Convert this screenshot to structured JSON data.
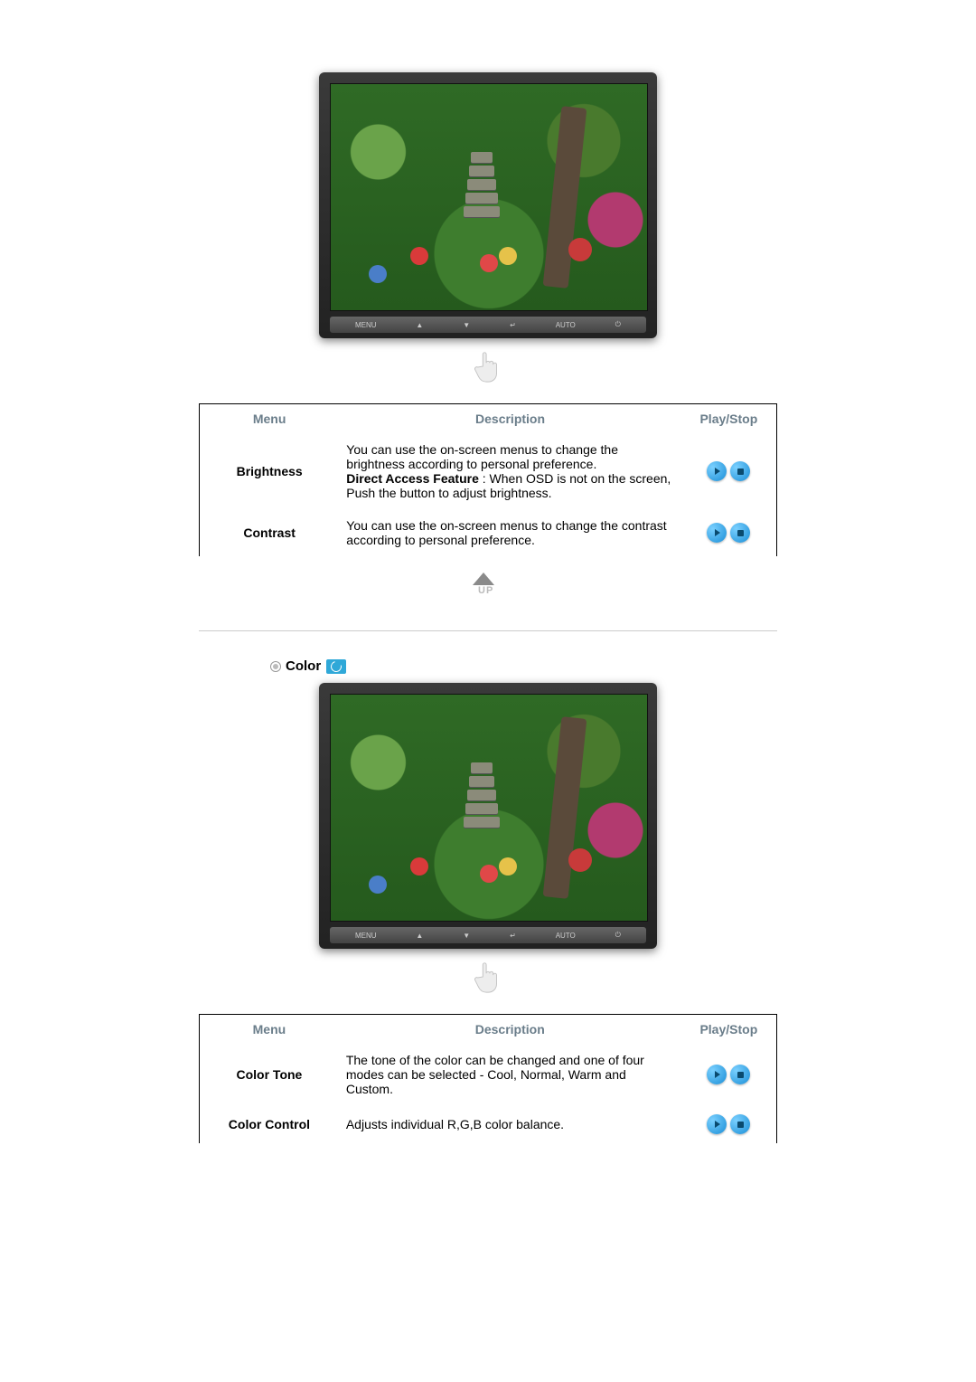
{
  "monitor_bar": {
    "b1": "MENU",
    "b2": "▲",
    "b3": "▼",
    "b4": "↵",
    "b5": "AUTO",
    "b6": "⏻"
  },
  "table1": {
    "head_menu": "Menu",
    "head_desc": "Description",
    "head_play": "Play/Stop",
    "rows": [
      {
        "menu": "Brightness",
        "desc_a": "You can use the on-screen menus to change the brightness according to personal preference.",
        "desc_b_bold": "Direct Access Feature",
        "desc_b_rest": " : When OSD is not on the screen, Push the button to adjust brightness."
      },
      {
        "menu": "Contrast",
        "desc_a": "You can use the on-screen menus to change the contrast according to personal preference."
      }
    ]
  },
  "up_label": "UP",
  "section2_title": "Color",
  "table2": {
    "head_menu": "Menu",
    "head_desc": "Description",
    "head_play": "Play/Stop",
    "rows": [
      {
        "menu": "Color Tone",
        "desc_a": "The tone of the color can be changed and one of four modes can be selected - Cool, Normal, Warm and Custom."
      },
      {
        "menu": "Color Control",
        "desc_a": "Adjusts individual R,G,B color balance."
      }
    ]
  }
}
